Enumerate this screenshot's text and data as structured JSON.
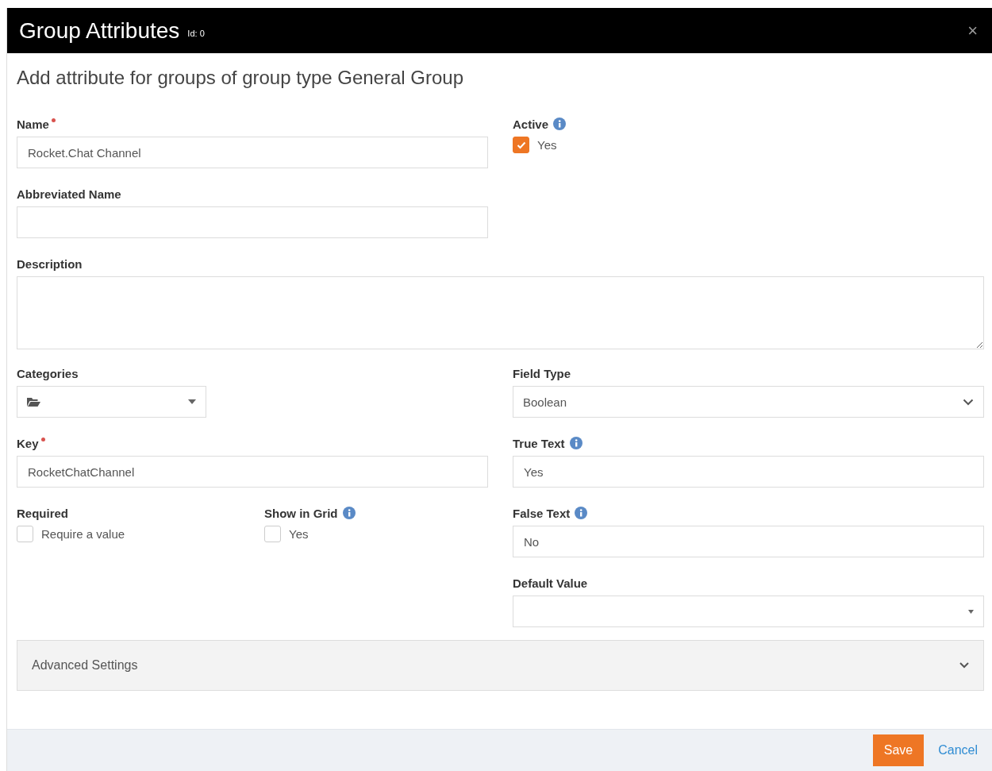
{
  "window": {
    "title": "Group Attributes",
    "id_label": "Id: 0",
    "close": "×"
  },
  "subtitle": "Add attribute for groups of group type General Group",
  "name": {
    "label": "Name",
    "required": true,
    "value": "Rocket.Chat Channel"
  },
  "active": {
    "label": "Active",
    "info": true,
    "option": "Yes",
    "checked": true
  },
  "abbreviated_name": {
    "label": "Abbreviated Name"
  },
  "description": {
    "label": "Description"
  },
  "categories": {
    "label": "Categories"
  },
  "field_type": {
    "label": "Field Type",
    "value": "Boolean"
  },
  "key": {
    "label": "Key",
    "required": true,
    "value": "RocketChatChannel"
  },
  "true_text": {
    "label": "True Text",
    "info": true,
    "value": "Yes"
  },
  "required": {
    "label": "Required",
    "option": "Require a value",
    "checked": false
  },
  "show_in_grid": {
    "label": "Show in Grid",
    "info": true,
    "option": "Yes",
    "checked": false
  },
  "false_text": {
    "label": "False Text",
    "info": true,
    "value": "No"
  },
  "default_value": {
    "label": "Default Value"
  },
  "advanced_settings": {
    "label": "Advanced Settings",
    "expanded": false
  },
  "buttons": [
    {
      "kind": "primary",
      "label": "Save"
    },
    {
      "kind": "link",
      "label": "Cancel"
    }
  ]
}
